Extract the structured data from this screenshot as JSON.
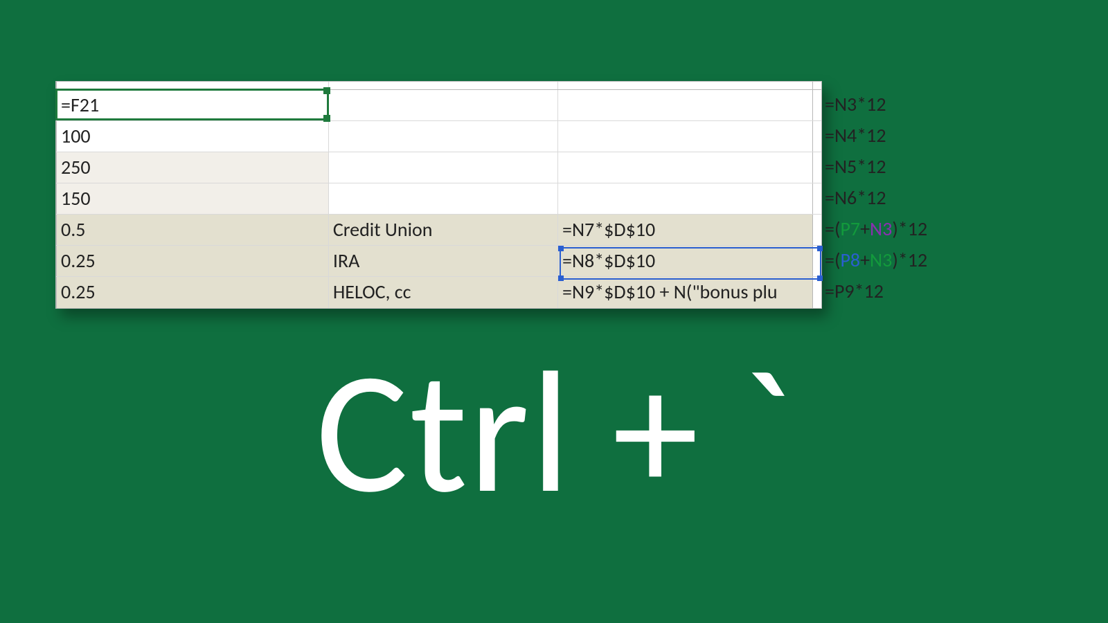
{
  "grid": {
    "rows": [
      {
        "band": "none",
        "c1": "=F21",
        "c2": "",
        "c3": "",
        "c4": "=N3*12"
      },
      {
        "band": "none",
        "c1": "100",
        "c2": "",
        "c3": "",
        "c4": "=N4*12"
      },
      {
        "band": "light",
        "c1": "250",
        "c2": "",
        "c3": "",
        "c4": "=N5*12"
      },
      {
        "band": "light",
        "c1": "150",
        "c2": "",
        "c3": "",
        "c4": "=N6*12"
      },
      {
        "band": "dark",
        "c1": "0.5",
        "c2": "Credit Union",
        "c3": "=N7*$D$10",
        "c4": {
          "plain1": "=(",
          "ref1": "P7",
          "plain2": "+",
          "ref2": "N3",
          "plain3": ")*12"
        }
      },
      {
        "band": "dark",
        "c1": "0.25",
        "c2": "IRA",
        "c3": "=N8*$D$10",
        "c4": {
          "plain1": "=(",
          "ref1": "P8",
          "plain2": "+",
          "ref2": "N3",
          "plain3": ")*12"
        }
      },
      {
        "band": "dark",
        "c1": "0.25",
        "c2": "HELOC, cc",
        "c3": "=N9*$D$10 + N(\"bonus plu",
        "c4": "=P9*12"
      }
    ]
  },
  "shortcut_label": "Ctrl + `"
}
